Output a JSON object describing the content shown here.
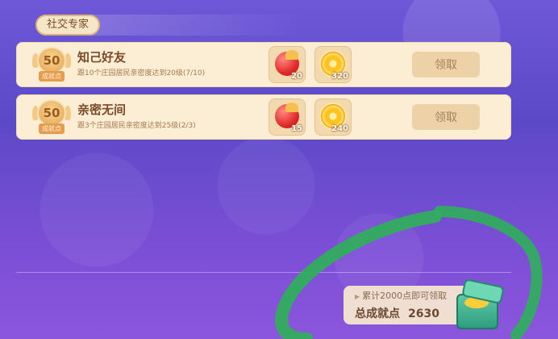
{
  "section": {
    "title": "社交专家"
  },
  "achievements": [
    {
      "badge_points": "50",
      "badge_label": "成就点",
      "title": "知己好友",
      "description": "跟10个庄园居民亲密度达到20级(7/10)",
      "rewards": [
        {
          "icon": "red-gem-icon",
          "count": "20"
        },
        {
          "icon": "gold-coin-icon",
          "count": "320"
        }
      ],
      "claim_label": "领取"
    },
    {
      "badge_points": "50",
      "badge_label": "成就点",
      "title": "亲密无间",
      "description": "跟3个庄园居民亲密度达到25级(2/3)",
      "rewards": [
        {
          "icon": "red-gem-icon",
          "count": "15"
        },
        {
          "icon": "gold-coin-icon",
          "count": "240"
        }
      ],
      "claim_label": "领取"
    }
  ],
  "summary": {
    "hint": "累计2000点即可领取",
    "total_label": "总成就点",
    "total_value": "2630"
  },
  "colors": {
    "background": "#6a55d4",
    "card": "#fbeed4",
    "highlight_stroke": "#2fb05a"
  }
}
